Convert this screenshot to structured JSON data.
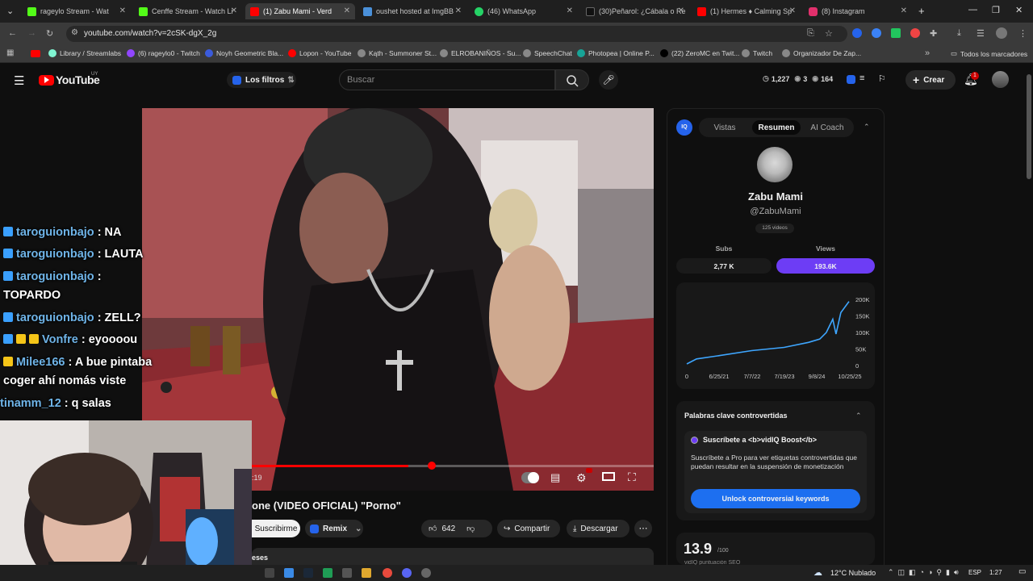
{
  "browser": {
    "tabs": [
      {
        "title": "rageylo Stream - Wat",
        "color": "#53fc18"
      },
      {
        "title": "Cenffe Stream - Watch Li",
        "color": "#53fc18"
      },
      {
        "title": "(1) Zabu Mami - Verd",
        "color": "#ff0000"
      },
      {
        "title": "oushet hosted at ImgBB",
        "color": "#4a90d9"
      },
      {
        "title": "(46) WhatsApp",
        "color": "#25d366"
      },
      {
        "title": "(30)Peñarol: ¿Cábala o Re",
        "color": "#111111"
      },
      {
        "title": "(1) Hermes ♦ Calming Sp",
        "color": "#ff0000"
      },
      {
        "title": "(8) Instagram",
        "color": "#e1306c"
      }
    ],
    "url": "youtube.com/watch?v=2cSK-dgX_2g",
    "bookmarks": [
      {
        "label": "Library / Streamlabs",
        "color": "#80f5d2"
      },
      {
        "label": "(6) rageylo0 - Twitch",
        "color": "#9146ff"
      },
      {
        "label": "Noyh Geometric Bla...",
        "color": "#3b5bdb"
      },
      {
        "label": "Lopon - YouTube",
        "color": "#ff0000"
      },
      {
        "label": "Kąth - Summoner St...",
        "color": "#888888"
      },
      {
        "label": "ELROBANIÑOS - Su...",
        "color": "#888888"
      },
      {
        "label": "SpeechChat",
        "color": "#888888"
      },
      {
        "label": "Photopea | Online P...",
        "color": "#18a497"
      },
      {
        "label": "(22) ZeroMC en Twit...",
        "color": "#000000"
      },
      {
        "label": "Twitch",
        "color": "#888888"
      },
      {
        "label": "Organizador De Zap...",
        "color": "#888888"
      }
    ],
    "all_bookmarks": "Todos los marcadores"
  },
  "youtube": {
    "logo": "YouTube",
    "region": "UY",
    "filters_label": "Los filtros",
    "search_placeholder": "Buscar",
    "stats": {
      "a": "1,227",
      "b": "3",
      "c": "164"
    },
    "create_label": "Crear",
    "notif_count": "1",
    "video_title": "one (VIDEO OFICIAL) \"Porno\"",
    "time_partial": ":19",
    "subscribe_label": "Suscribirme",
    "remix_label": "Remix",
    "likes": "642",
    "share_label": "Compartir",
    "download_label": "Descargar",
    "desc_partial": "eses",
    "progress_fraction": 0.52
  },
  "chat": [
    {
      "user": "taroguionbajo",
      "msg": ": NA"
    },
    {
      "user": "taroguionbajo",
      "msg": ": LAUTA"
    },
    {
      "user": "taroguionbajo",
      "msg": ":"
    },
    {
      "user": "",
      "msg": "TOPARDO"
    },
    {
      "user": "taroguionbajo",
      "msg": ": ZELL?"
    },
    {
      "user": "Vonfre",
      "msg": ": eyoooou"
    },
    {
      "user": "Milee166",
      "msg": ": A bue pintaba"
    },
    {
      "user": "",
      "msg": "coger ahí nomás viste"
    },
    {
      "user": "tinamm_12",
      "msg": ": q salas"
    }
  ],
  "vidiq": {
    "tabs": [
      "Vistas",
      "Resumen",
      "AI Coach"
    ],
    "channel_name": "Zabu Mami",
    "handle": "@ZabuMami",
    "videos": "125 videos",
    "subs_label": "Subs",
    "subs_value": "2,77 K",
    "views_label": "Views",
    "views_value": "193.6K",
    "chart_data": {
      "type": "line",
      "x": [
        "0",
        "6/25/21",
        "7/7/22",
        "7/19/23",
        "9/8/24",
        "10/25/25"
      ],
      "y_ticks": [
        "200K",
        "150K",
        "100K",
        "50K",
        "0"
      ],
      "ylim": [
        0,
        200000
      ],
      "values": [
        5000,
        20000,
        30000,
        45000,
        55000,
        70000,
        80000,
        100000,
        140000,
        95000,
        160000,
        193600
      ]
    },
    "keywords_title": "Palabras clave controvertidas",
    "boost_title": "Suscríbete a <b>vidIQ Boost</b>",
    "boost_desc": "Suscríbete a Pro para ver etiquetas controvertidas que puedan resultar en la suspensión de monetización",
    "unlock_label": "Unlock controversial keywords",
    "score": "13.9",
    "score_max": "/100",
    "score_label": "vidIQ puntuación SEO"
  },
  "taskbar": {
    "weather": "12°C Nublado",
    "lang": "ESP",
    "time": "1:27"
  }
}
